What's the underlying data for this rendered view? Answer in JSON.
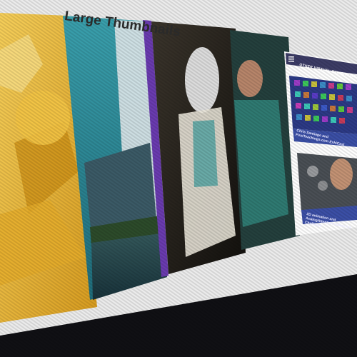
{
  "heading": {
    "text": "Large Thumbnails"
  },
  "sidebar_panel": {
    "title": "OTHER VIRTUAL EXHIBITIONS",
    "caption_1": "Chris Santiago and FirstTeachings.com ExhiCast",
    "caption_2": "2D animation and AnalogAttention makes it a Challenge"
  },
  "scene": {
    "colors": {
      "screen_bezel": "#1b1b20",
      "page_background": "#f2f2f2",
      "yellow_tile": "#e8b634",
      "teal_sky": "#2d8a98",
      "purple_accent": "#6a3bb0",
      "dark_tile": "#2a2620",
      "sidebar_blue": "#3b4fa6"
    }
  }
}
